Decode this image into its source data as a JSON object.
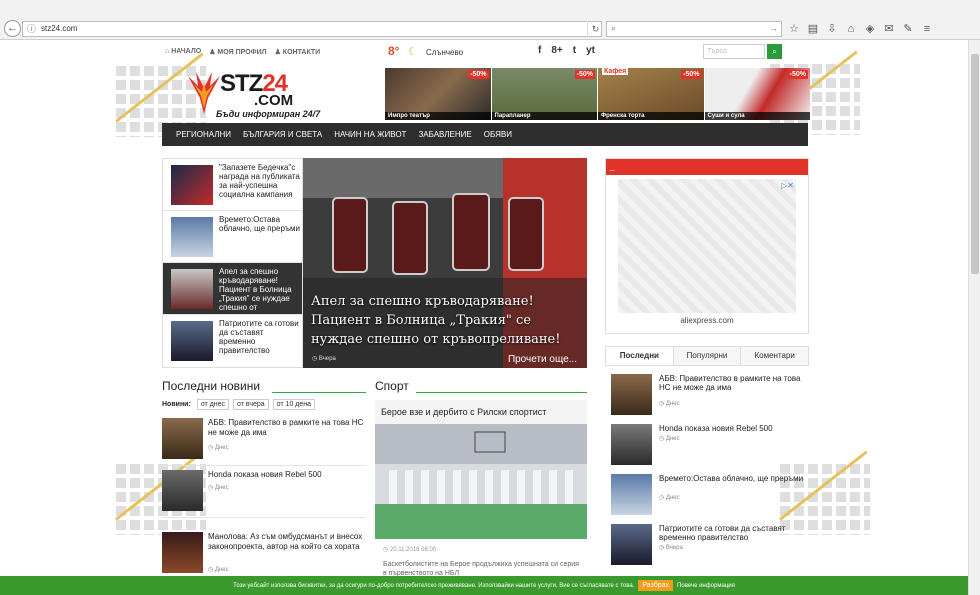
{
  "browser": {
    "url": "stz24.com",
    "search_placeholder": ""
  },
  "topnav": {
    "home": "НАЧАЛО",
    "profile": "МОЯ ПРОФИЛ",
    "contacts": "КОНТАКТИ"
  },
  "weather": {
    "temp": "8°",
    "condition": "Слънчево"
  },
  "social": [
    "f",
    "8+",
    "t",
    "yt"
  ],
  "site_search_placeholder": "Търсо",
  "logo": {
    "text_a": "STZ",
    "text_b": "24",
    "dotcom": ".COM",
    "tagline": "Бъди информиран 24/7"
  },
  "promos": [
    {
      "badge": "-50%",
      "caption": "Импро театър"
    },
    {
      "badge": "-50%",
      "caption": "Параплaнер"
    },
    {
      "badge": "-50%",
      "caption": "Френска торта"
    },
    {
      "badge": "-50%",
      "caption": "Суши и сула"
    }
  ],
  "promo_sign": "Кафея",
  "menu": [
    "РЕГИОНАЛНИ",
    "БЪЛГАРИЯ И СВЕТА",
    "НАЧИН НА ЖИВОТ",
    "ЗАБАВЛЕНИЕ",
    "ОБЯВИ"
  ],
  "featured": {
    "items": [
      "\"Запазете Бедечка\"с награда на публиката за най-успешна социална кампания",
      "Времето:Остава облачно, ще преръми",
      "Апел за спешно кръводаряване! Пациент в Болница „Тракия\" се нуждае спешно от кръвопреливане!",
      "Патриотите са готови да съставят временно правителство"
    ],
    "main_caption": "Апел за спешно кръводаряване! Пациент в Болница „Тракия\" се нуждае спешно от кръвопреливане!",
    "main_meta": "Вчера",
    "more": "Прочети още..."
  },
  "ad": {
    "source": "aliexpress.com",
    "choices": "▷✕"
  },
  "latest": {
    "title": "Последни новини",
    "filter_label": "Новини:",
    "filters": [
      "от днес",
      "от вчера",
      "от 10 дена"
    ],
    "items": [
      {
        "title": "АБВ: Правителство в рамките на това НС не може да има",
        "when": "Днес"
      },
      {
        "title": "Honda показа новия Rebel 500",
        "when": "Днес"
      },
      {
        "title": "Манолова: Аз съм омбудсманът и внесох законопроекта, автор на който са хората",
        "when": "Днес"
      }
    ]
  },
  "sport": {
    "title": "Спорт",
    "headline": "Берое взе и дербито с Рилски спортист",
    "date": "20.11.2016 08:00",
    "text": "Баскетболистите на Берое продължиха успешната си серия в първенството на НБЛ"
  },
  "tabs": [
    "Последни",
    "Популярни",
    "Коментари"
  ],
  "sidebar": [
    {
      "title": "АБВ: Правителство в рамките на това НС не може да има",
      "when": "Днес"
    },
    {
      "title": "Honda показа новия Rebel 500",
      "when": "Днес"
    },
    {
      "title": "Времето:Остава облачно, ще преръми",
      "when": "Днес"
    },
    {
      "title": "Патриотите са готови да съставят временно правителство",
      "when": "Вчера"
    }
  ],
  "cookie": {
    "text": "Този уебсайт използва бисквитки, за да осигури по-добро потребителско преживяване. Използвайки нашите услуги, Вие се съгласявате с това.",
    "agree": "Разбрах",
    "more": "Повече информация"
  },
  "colors": {
    "accent_red": "#e1332a",
    "accent_green": "#2ea836",
    "menu_bg": "#2e2e2e",
    "cookie_bg": "#3a9a2c"
  }
}
